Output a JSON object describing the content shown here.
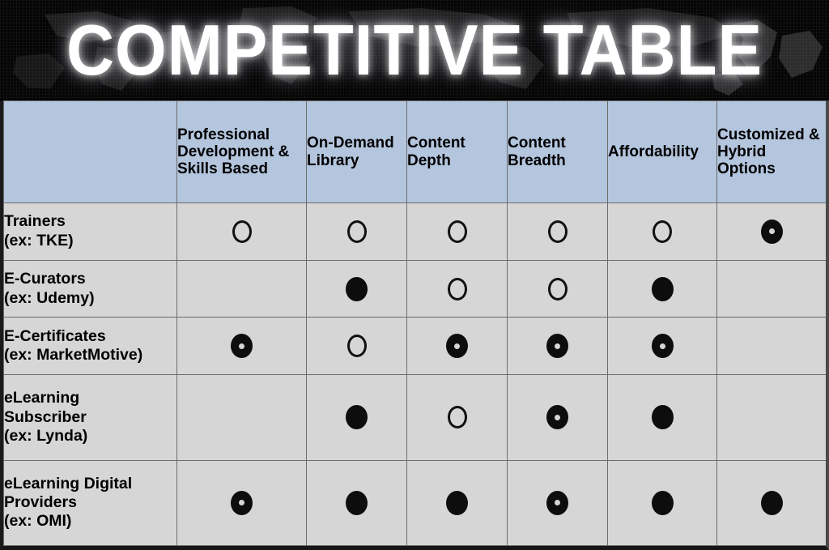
{
  "banner": {
    "title": "COMPETITIVE TABLE",
    "background_color": "#050505",
    "text_color": "#ffffff",
    "map_icon": "world-map-icon"
  },
  "table": {
    "header_background": "#b4c5de",
    "body_background": "#d6d6d6",
    "gridline_color": "#6d6d6d",
    "corner_label": "",
    "columns": [
      "Professional Development & Skills Based",
      "On-Demand Library",
      "Content Depth",
      "Content Breadth",
      "Affordability",
      "Customized & Hybrid Options"
    ],
    "rows": [
      {
        "label": "Trainers\n(ex: TKE)",
        "name": "Trainers",
        "example": "ex: TKE",
        "marks": [
          "hollow",
          "hollow",
          "hollow",
          "hollow",
          "hollow",
          "bullseye"
        ]
      },
      {
        "label": "E-Curators\n(ex: Udemy)",
        "name": "E-Curators",
        "example": "ex: Udemy",
        "marks": [
          "none",
          "filled",
          "hollow",
          "hollow",
          "filled",
          "none"
        ]
      },
      {
        "label": "E-Certificates\n(ex: MarketMotive)",
        "name": "E-Certificates",
        "example": "ex: MarketMotive",
        "marks": [
          "bullseye",
          "hollow",
          "bullseye",
          "bullseye",
          "bullseye",
          "none"
        ]
      },
      {
        "label": "eLearning\nSubscriber\n(ex: Lynda)",
        "name": "eLearning Subscriber",
        "example": "ex: Lynda",
        "marks": [
          "none",
          "filled",
          "hollow",
          "bullseye",
          "filled",
          "none"
        ]
      },
      {
        "label": "eLearning Digital\nProviders\n(ex: OMI)",
        "name": "eLearning Digital Providers",
        "example": "ex: OMI",
        "marks": [
          "bullseye",
          "filled",
          "filled",
          "bullseye",
          "filled",
          "filled"
        ]
      }
    ]
  },
  "chart_data": {
    "type": "table",
    "title": "COMPETITIVE TABLE",
    "categories": [
      "Professional Development & Skills Based",
      "On-Demand Library",
      "Content Depth",
      "Content Breadth",
      "Affordability",
      "Customized & Hybrid Options"
    ],
    "row_labels": [
      "Trainers (ex: TKE)",
      "E-Curators (ex: Udemy)",
      "E-Certificates (ex: MarketMotive)",
      "eLearning Subscriber (ex: Lynda)",
      "eLearning Digital Providers (ex: OMI)"
    ],
    "symbol_legend": {
      "hollow": "open circle",
      "filled": "solid filled circle",
      "bullseye": "filled circle with white center dot",
      "none": "empty cell / no marker"
    },
    "values": [
      [
        "hollow",
        "hollow",
        "hollow",
        "hollow",
        "hollow",
        "bullseye"
      ],
      [
        "none",
        "filled",
        "hollow",
        "hollow",
        "filled",
        "none"
      ],
      [
        "bullseye",
        "hollow",
        "bullseye",
        "bullseye",
        "bullseye",
        "none"
      ],
      [
        "none",
        "filled",
        "hollow",
        "bullseye",
        "filled",
        "none"
      ],
      [
        "bullseye",
        "filled",
        "filled",
        "bullseye",
        "filled",
        "filled"
      ]
    ],
    "xlabel": "",
    "ylabel": "",
    "grid": true,
    "legend_position": "none"
  }
}
